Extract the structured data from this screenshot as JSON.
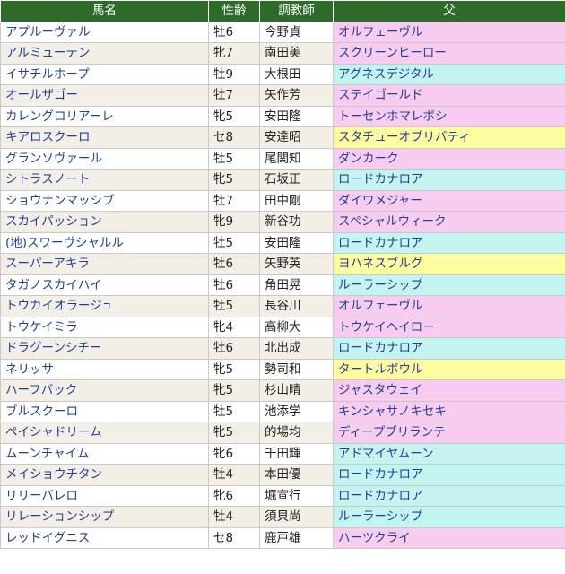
{
  "headers": {
    "name": "馬名",
    "sex_age": "性齢",
    "trainer": "調教師",
    "sire": "父"
  },
  "colors": {
    "header_bg": "#2e6b2a",
    "pink": "#f7ccee",
    "cyan": "#c4f4f0",
    "yellow": "#fdfc9e"
  },
  "rows": [
    {
      "name": "アプルーヴァル",
      "sex_age": "牡6",
      "trainer": "今野貞",
      "sire": "オルフェーヴル",
      "color": "pink"
    },
    {
      "name": "アルミューテン",
      "sex_age": "牝7",
      "trainer": "南田美",
      "sire": "スクリーンヒーロー",
      "color": "pink"
    },
    {
      "name": "イサチルホープ",
      "sex_age": "牡9",
      "trainer": "大根田",
      "sire": "アグネスデジタル",
      "color": "cyan"
    },
    {
      "name": "オールザゴー",
      "sex_age": "牡7",
      "trainer": "矢作芳",
      "sire": "ステイゴールド",
      "color": "pink"
    },
    {
      "name": "カレングロリアーレ",
      "sex_age": "牝5",
      "trainer": "安田隆",
      "sire": "トーセンホマレボシ",
      "color": "pink"
    },
    {
      "name": "キアロスクーロ",
      "sex_age": "セ8",
      "trainer": "安達昭",
      "sire": "スタチューオブリバティ",
      "color": "yellow"
    },
    {
      "name": "グランソヴァール",
      "sex_age": "牡5",
      "trainer": "尾関知",
      "sire": "ダンカーク",
      "color": "pink"
    },
    {
      "name": "シトラスノート",
      "sex_age": "牝5",
      "trainer": "石坂正",
      "sire": "ロードカナロア",
      "color": "cyan"
    },
    {
      "name": "ショウナンマッシブ",
      "sex_age": "牡7",
      "trainer": "田中剛",
      "sire": "ダイワメジャー",
      "color": "pink"
    },
    {
      "name": "スカイパッション",
      "sex_age": "牝9",
      "trainer": "新谷功",
      "sire": "スペシャルウィーク",
      "color": "pink"
    },
    {
      "name": "(地)スワーヴシャルル",
      "sex_age": "牡5",
      "trainer": "安田隆",
      "sire": "ロードカナロア",
      "color": "cyan"
    },
    {
      "name": "スーパーアキラ",
      "sex_age": "牡6",
      "trainer": "矢野英",
      "sire": "ヨハネスブルグ",
      "color": "yellow"
    },
    {
      "name": "タガノスカイハイ",
      "sex_age": "牡6",
      "trainer": "角田晃",
      "sire": "ルーラーシップ",
      "color": "cyan"
    },
    {
      "name": "トウカイオラージュ",
      "sex_age": "牡5",
      "trainer": "長谷川",
      "sire": "オルフェーヴル",
      "color": "pink"
    },
    {
      "name": "トウケイミラ",
      "sex_age": "牝4",
      "trainer": "高柳大",
      "sire": "トウケイヘイロー",
      "color": "pink"
    },
    {
      "name": "ドラグーンシチー",
      "sex_age": "牡6",
      "trainer": "北出成",
      "sire": "ロードカナロア",
      "color": "cyan"
    },
    {
      "name": "ネリッサ",
      "sex_age": "牝5",
      "trainer": "勢司和",
      "sire": "タートルボウル",
      "color": "yellow"
    },
    {
      "name": "ハーフバック",
      "sex_age": "牝5",
      "trainer": "杉山晴",
      "sire": "ジャスタウェイ",
      "color": "pink"
    },
    {
      "name": "ブルスクーロ",
      "sex_age": "牡5",
      "trainer": "池添学",
      "sire": "キンシャサノキセキ",
      "color": "pink"
    },
    {
      "name": "ペイシャドリーム",
      "sex_age": "牝5",
      "trainer": "的場均",
      "sire": "ディープブリランテ",
      "color": "pink"
    },
    {
      "name": "ムーンチャイム",
      "sex_age": "牝6",
      "trainer": "千田輝",
      "sire": "アドマイヤムーン",
      "color": "cyan"
    },
    {
      "name": "メイショウチタン",
      "sex_age": "牡4",
      "trainer": "本田優",
      "sire": "ロードカナロア",
      "color": "cyan"
    },
    {
      "name": "リリーバレロ",
      "sex_age": "牝6",
      "trainer": "堀宣行",
      "sire": "ロードカナロア",
      "color": "cyan"
    },
    {
      "name": "リレーションシップ",
      "sex_age": "牡4",
      "trainer": "須貝尚",
      "sire": "ルーラーシップ",
      "color": "cyan"
    },
    {
      "name": "レッドイグニス",
      "sex_age": "セ8",
      "trainer": "鹿戸雄",
      "sire": "ハーツクライ",
      "color": "pink"
    }
  ]
}
